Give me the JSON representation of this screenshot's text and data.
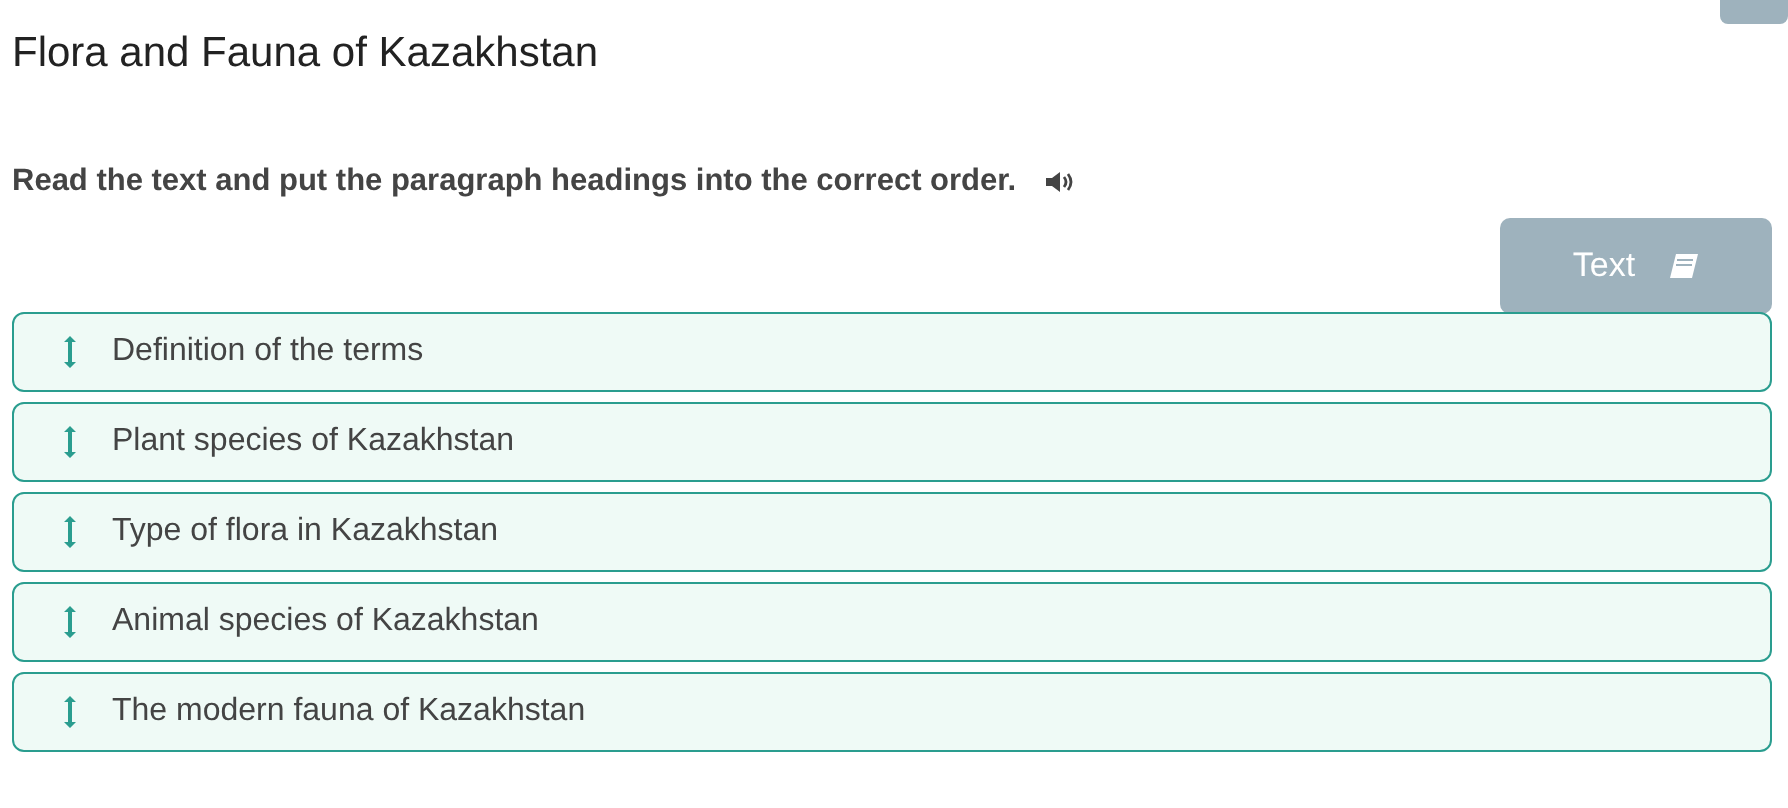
{
  "title": "Flora and Fauna of Kazakhstan",
  "instruction": "Read the text and put the paragraph headings into the correct order.",
  "text_button": {
    "label": "Text"
  },
  "headings": [
    {
      "label": "Definition of the terms"
    },
    {
      "label": "Plant species of Kazakhstan"
    },
    {
      "label": "Type of flora in Kazakhstan"
    },
    {
      "label": "Animal species of Kazakhstan"
    },
    {
      "label": "The modern fauna of Kazakhstan"
    }
  ]
}
